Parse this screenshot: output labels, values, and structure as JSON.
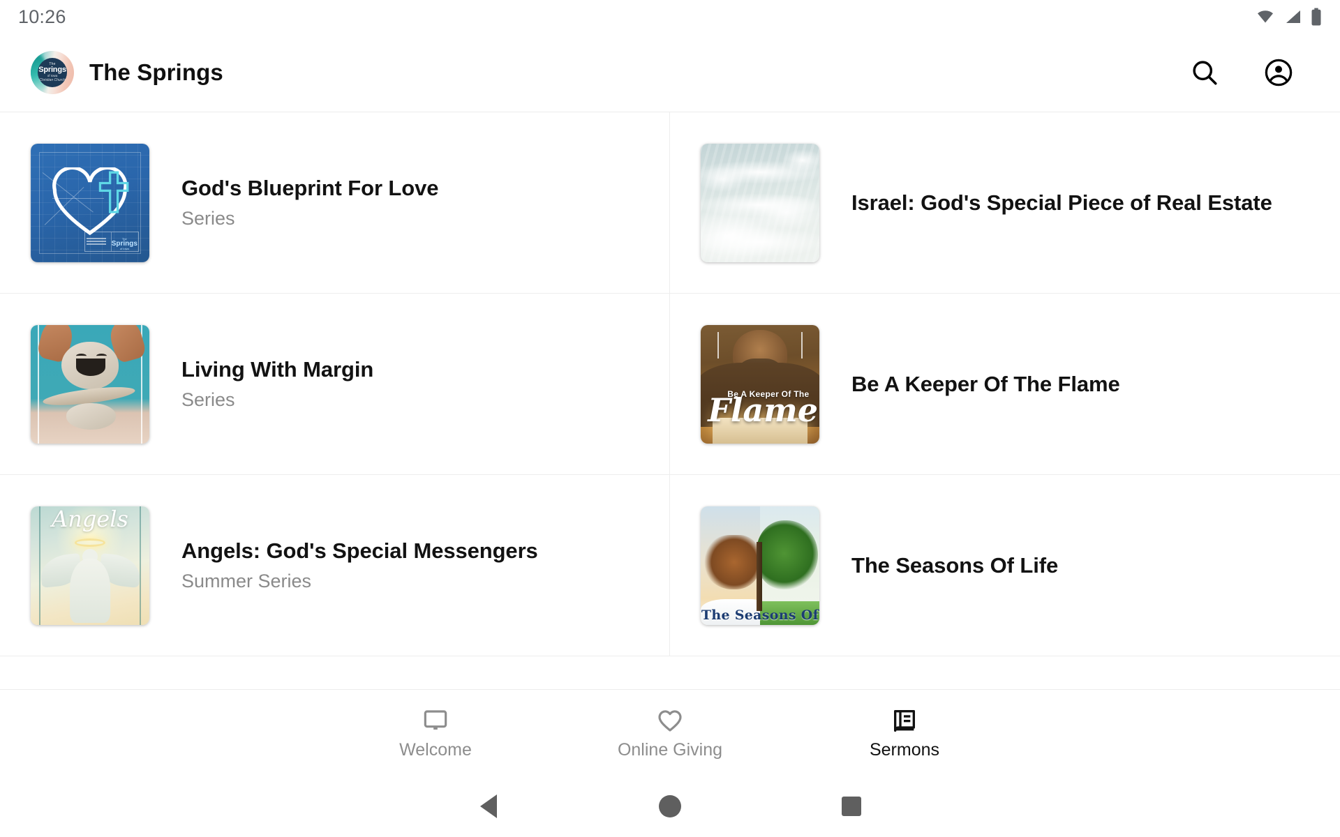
{
  "status_bar": {
    "time": "10:26",
    "icons": [
      "wifi-icon",
      "cell-signal-icon",
      "battery-icon"
    ]
  },
  "app_bar": {
    "title": "The Springs",
    "logo": {
      "name": "the-springs-logo",
      "line1": "The",
      "line2": "Springs",
      "line3": "of Iowa",
      "line4": "Christian Church"
    },
    "actions": [
      {
        "name": "search-icon",
        "label": "Search"
      },
      {
        "name": "account-circle-icon",
        "label": "Account"
      }
    ]
  },
  "sermons_list": {
    "items": [
      {
        "title": "God's Blueprint For Love",
        "subtitle": "Series",
        "thumb": "blueprint-heart-cross-artwork",
        "art": {
          "badge_label": "The Springs",
          "logo_l1": "The",
          "logo_l2": "Springs",
          "logo_l3": "of Iowa"
        }
      },
      {
        "title": "Israel: God's Special Piece of Real Estate",
        "subtitle": "",
        "thumb": "ocean-water-foam-artwork"
      },
      {
        "title": "Living With Margin",
        "subtitle": "Series",
        "thumb": "balancing-stones-smiley-artwork"
      },
      {
        "title": "Be A Keeper Of The Flame",
        "subtitle": "",
        "thumb": "bearded-man-glowing-book-artwork",
        "art": {
          "overline": "Be A Keeper Of The",
          "wordmark": "Flame"
        }
      },
      {
        "title": "Angels: God's Special Messengers",
        "subtitle": "Summer Series",
        "thumb": "angel-silhouette-halo-artwork",
        "art": {
          "wordmark": "Angels"
        }
      },
      {
        "title": "The Seasons Of Life",
        "subtitle": "",
        "thumb": "split-season-tree-artwork",
        "art": {
          "caption": "The Seasons Of"
        }
      }
    ]
  },
  "bottom_nav": {
    "items": [
      {
        "label": "Welcome",
        "icon": "monitor-icon",
        "active": false
      },
      {
        "label": "Online Giving",
        "icon": "heart-outline-icon",
        "active": false
      },
      {
        "label": "Sermons",
        "icon": "article-reader-icon",
        "active": true
      }
    ]
  },
  "system_nav": {
    "back": "back-triangle-icon",
    "home": "home-circle-icon",
    "recents": "recents-square-icon"
  },
  "colors": {
    "background": "#ffffff",
    "title_text": "#121212",
    "subtitle_text": "#8a8a8a",
    "divider": "#ededed",
    "nav_inactive": "#8d8d8d",
    "nav_active": "#121212",
    "system_nav_icon": "#5f5f5f"
  }
}
